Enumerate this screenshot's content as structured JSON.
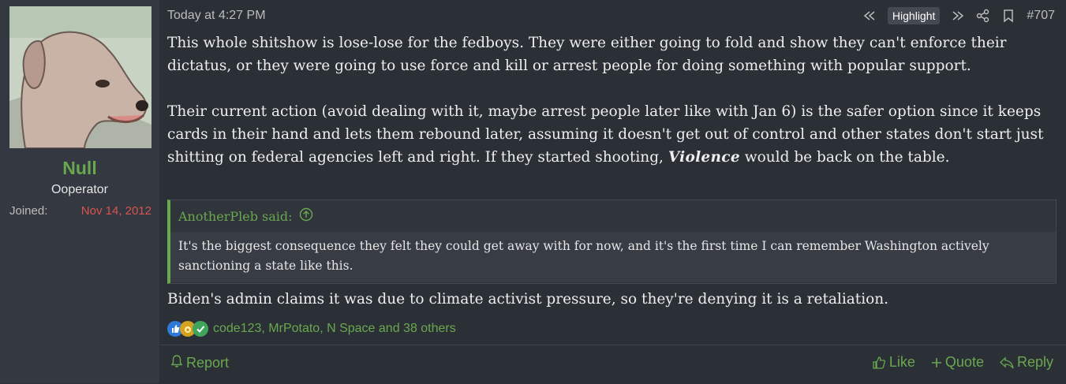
{
  "user": {
    "name": "Null",
    "title": "Ooperator",
    "joined_label": "Joined:",
    "joined_date": "Nov 14, 2012"
  },
  "post": {
    "timestamp": "Today at 4:27 PM",
    "highlight_label": "Highlight",
    "post_number": "#707",
    "paragraph1": "This whole shitshow is lose-lose for the fedboys. They were either going to fold and show they can't enforce their dictatus, or they were going to use force and kill or arrest people for doing something with popular support.",
    "paragraph2_before": "Their current action (avoid dealing with it, maybe arrest people later like with Jan 6) is the safer option since it keeps cards in their hand and lets them rebound later, assuming it doesn't get out of control and other states don't start just shitting on federal agencies left and right. If they started shooting, ",
    "paragraph2_styled": "Violence",
    "paragraph2_after": " would be back on the table.",
    "quote": {
      "author_said": "AnotherPleb said:",
      "text": "It's the biggest consequence they felt they could get away with for now, and it's the first time I can remember Washington actively sanctioning a state like this."
    },
    "reply_text": "Biden's admin claims it was due to climate activist pressure, so they're denying it is a retaliation.",
    "reactions_text": "code123, MrPotato, N Space and 38 others"
  },
  "footer": {
    "report": "Report",
    "like": "Like",
    "quote": "Quote",
    "reply": "Reply"
  },
  "colors": {
    "accent_green": "#6aa84f",
    "joined_red": "#d9534f",
    "background": "#2b2f36",
    "sidebar": "#343840"
  },
  "icons": [
    "dog-avatar",
    "rewind-icon",
    "forward-icon",
    "share-icon",
    "bookmark-icon",
    "up-arrow-circle-icon",
    "like-reaction-icon",
    "medal-reaction-icon",
    "check-reaction-icon",
    "bell-icon",
    "thumbs-up-icon",
    "plus-icon",
    "reply-icon"
  ]
}
